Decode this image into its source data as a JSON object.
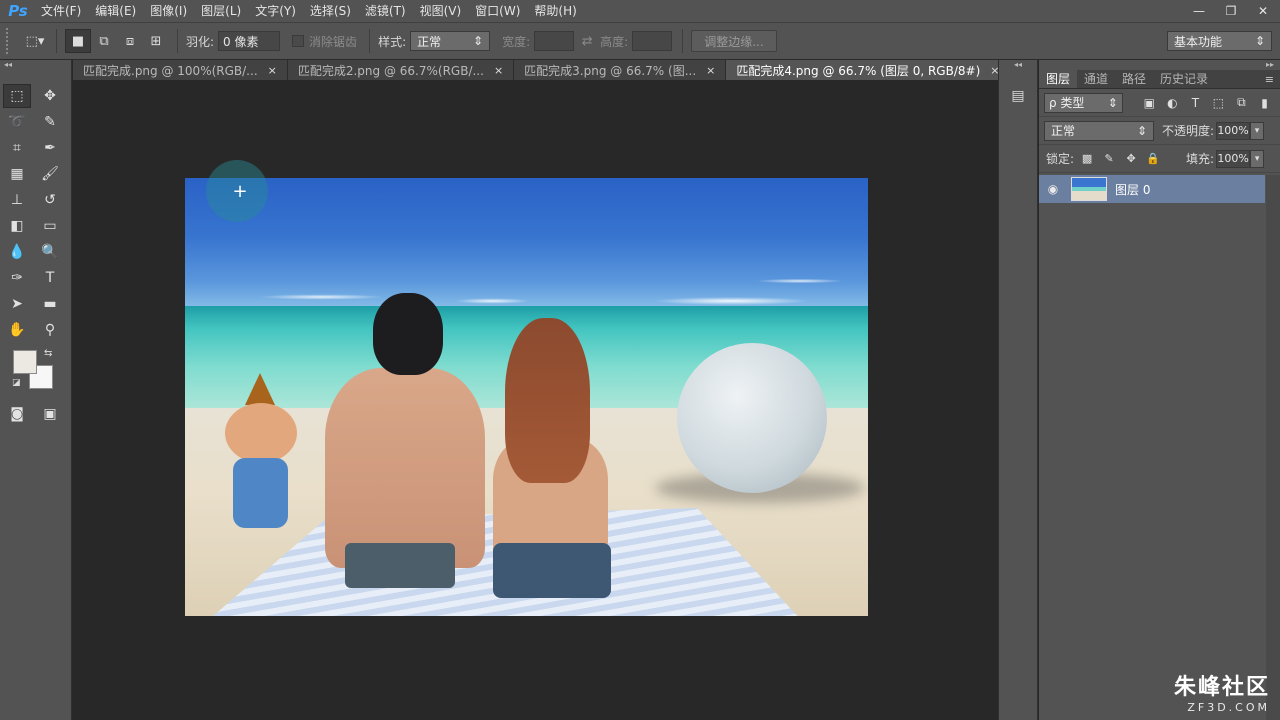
{
  "app": {
    "logo": "Ps"
  },
  "menu": [
    "文件(F)",
    "编辑(E)",
    "图像(I)",
    "图层(L)",
    "文字(Y)",
    "选择(S)",
    "滤镜(T)",
    "视图(V)",
    "窗口(W)",
    "帮助(H)"
  ],
  "window_controls": {
    "minimize": "—",
    "restore": "❐",
    "close": "✕"
  },
  "options": {
    "feather_label": "羽化:",
    "feather_value": "0 像素",
    "antialias_label": "消除锯齿",
    "style_label": "样式:",
    "style_value": "正常",
    "width_label": "宽度:",
    "height_label": "高度:",
    "refine_edge": "调整边缘...",
    "workspace": "基本功能"
  },
  "tabs": [
    {
      "label": "匹配完成.png @ 100%(RGB/...",
      "close": "×"
    },
    {
      "label": "匹配完成2.png @ 66.7%(RGB/...",
      "close": "×"
    },
    {
      "label": "匹配完成3.png @ 66.7% (图...",
      "close": "×"
    },
    {
      "label": "匹配完成4.png @ 66.7% (图层 0, RGB/8#)",
      "close": "×"
    }
  ],
  "layers_panel": {
    "tabs": [
      "图层",
      "通道",
      "路径",
      "历史记录"
    ],
    "kind_filter": "ρ 类型",
    "blend_mode": "正常",
    "opacity_label": "不透明度:",
    "opacity_value": "100%",
    "lock_label": "锁定:",
    "fill_label": "填充:",
    "fill_value": "100%",
    "layers": [
      {
        "name": "图层 0",
        "visible": true,
        "selected": true
      }
    ]
  },
  "watermark": {
    "main": "朱峰社区",
    "sub": "ZF3D.COM"
  },
  "colors": {
    "foreground": "#ece9e3",
    "background": "#f7f7f7",
    "accent": "#3fa4ff",
    "selected_layer": "#6b7fa0"
  }
}
